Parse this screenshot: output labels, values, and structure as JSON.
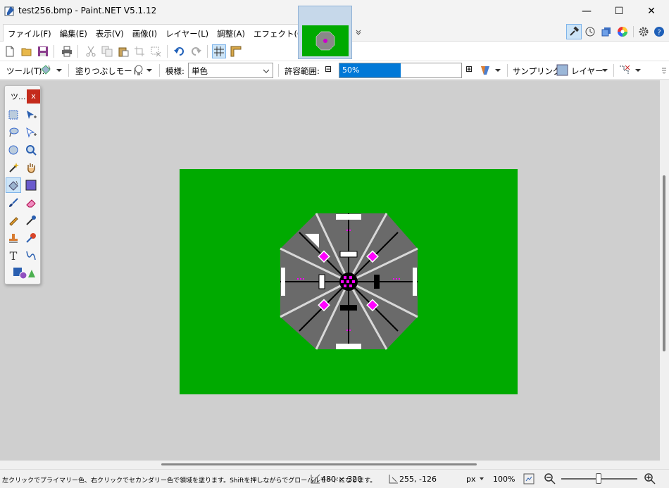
{
  "window": {
    "title": "test256.bmp - Paint.NET V5.1.12",
    "controls": {
      "minimize": "—",
      "maximize": "☐",
      "close": "✕"
    }
  },
  "menu": [
    {
      "label": "ファイル(F)"
    },
    {
      "label": "編集(E)"
    },
    {
      "label": "表示(V)"
    },
    {
      "label": "画像(I)"
    },
    {
      "label": "レイヤー(L)"
    },
    {
      "label": "調整(A)"
    },
    {
      "label": "エフェクト(C)"
    }
  ],
  "tool_options": {
    "tool_label": "ツール(T):",
    "fill_mode_label": "塗りつぶしモード:",
    "pattern_label": "模様:",
    "pattern_value": "単色",
    "tolerance_label": "許容範囲:",
    "tolerance_value": "50%",
    "tolerance_fraction": 0.5,
    "sampling_label": "サンプリング:",
    "sampling_value": "レイヤー",
    "tolerance_minus": "⊟",
    "tolerance_plus": "⊞"
  },
  "toolbox": {
    "title": "ツ...",
    "close": "x"
  },
  "colors": {
    "canvas_bg": "#00aa00",
    "workspace_bg": "#cfcfcf",
    "accent": "#0078d7",
    "close_red": "#c42b1c",
    "magenta": "#ff00ff"
  },
  "status": {
    "hint": "左クリックでプライマリー色、右クリックでセカンダリー色で領域を塗ります。Shiftを押しながらでグローバルモードになります。",
    "image_size": "480 × 320",
    "cursor_pos": "255, -126",
    "unit": "px",
    "zoom": "100%"
  }
}
